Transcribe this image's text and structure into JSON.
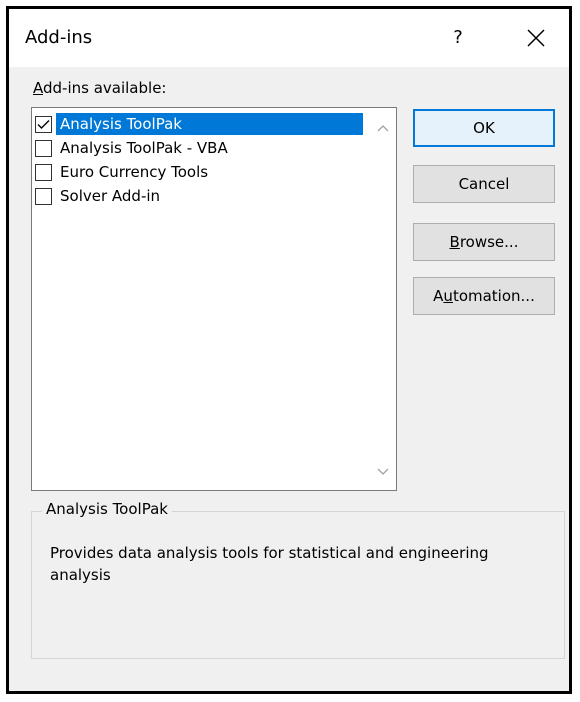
{
  "dialog": {
    "title": "Add-ins",
    "help_label": "?",
    "close_icon": "close-icon"
  },
  "list": {
    "label_accel": "A",
    "label_rest": "dd-ins available:",
    "items": [
      {
        "label": "Analysis ToolPak",
        "checked": true,
        "selected": true
      },
      {
        "label": "Analysis ToolPak - VBA",
        "checked": false,
        "selected": false
      },
      {
        "label": "Euro Currency Tools",
        "checked": false,
        "selected": false
      },
      {
        "label": "Solver Add-in",
        "checked": false,
        "selected": false
      }
    ]
  },
  "buttons": {
    "ok": "OK",
    "cancel": "Cancel",
    "browse_accel": "B",
    "browse_rest": "rowse...",
    "automation_pre": "A",
    "automation_accel": "u",
    "automation_rest": "tomation..."
  },
  "details": {
    "title": "Analysis ToolPak",
    "description": "Provides data analysis tools for statistical and engineering analysis"
  },
  "colors": {
    "selection": "#0078d7",
    "dialog_bg": "#f0f0f0"
  }
}
